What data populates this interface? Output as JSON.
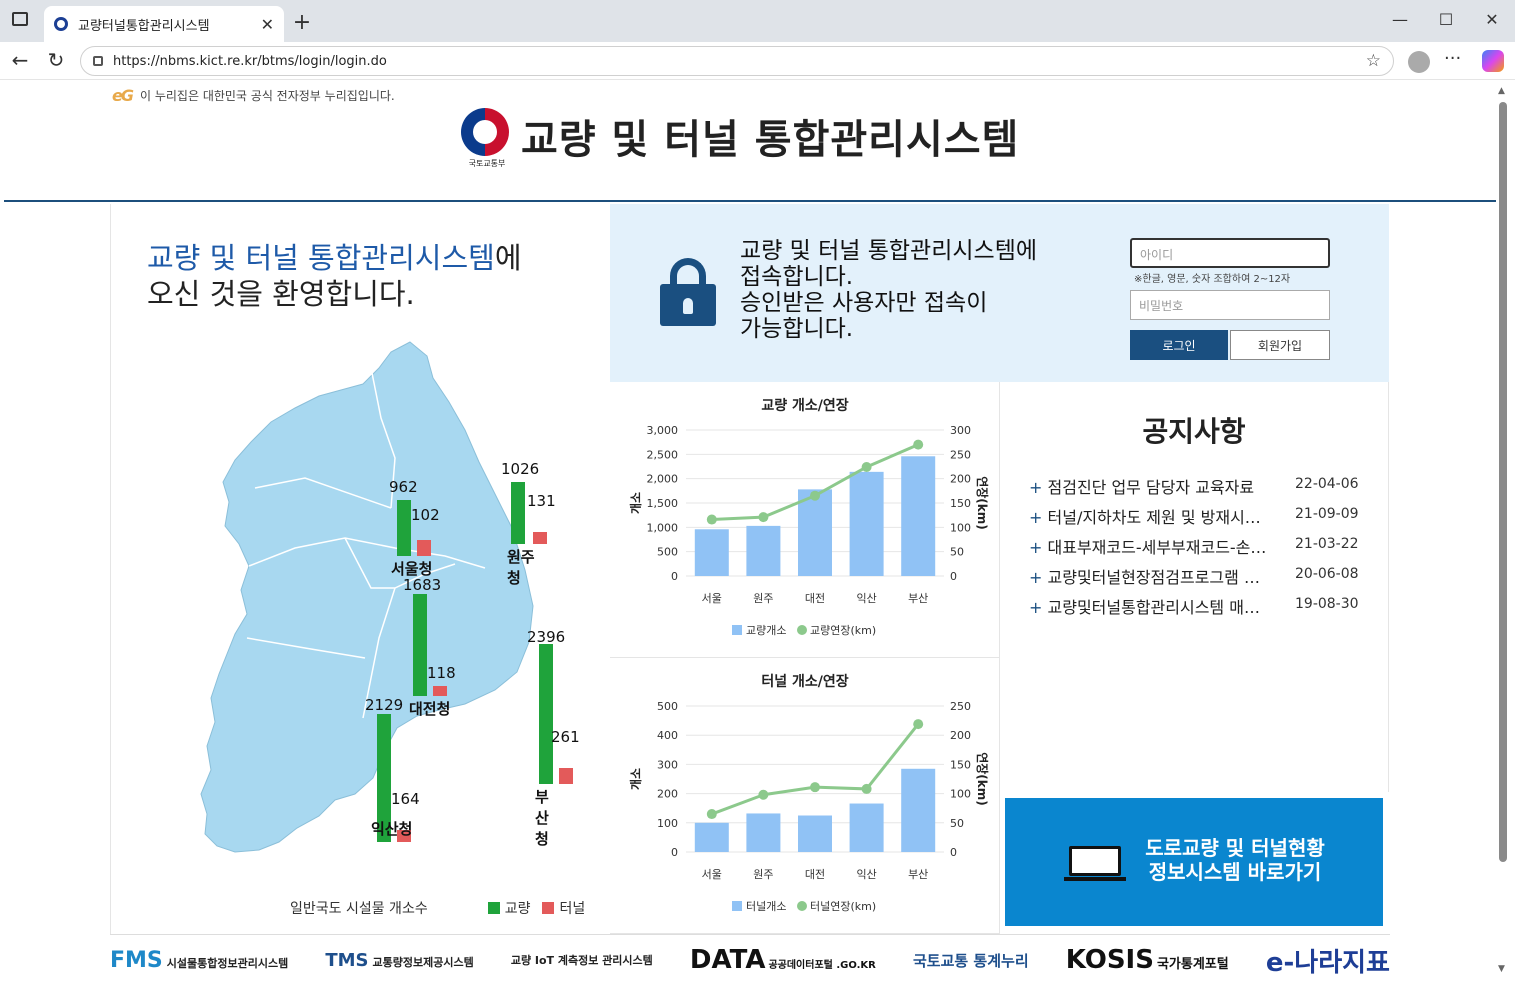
{
  "browser": {
    "tab_title": "교량터널통합관리시스템",
    "url": "https://nbms.kict.re.kr/btms/login/login.do"
  },
  "gov_notice": "이 누리집은 대한민국 공식 전자정부 누리집입니다.",
  "header": {
    "ministry": "국토교통부",
    "title": "교량 및 터널 통합관리시스템"
  },
  "welcome": {
    "highlight": "교량 및 터널 통합관리시스템",
    "suffix": "에",
    "line2": "오신 것을 환영합니다."
  },
  "map": {
    "regions": [
      {
        "name": "서울청",
        "bridges": 962,
        "tunnels": 102
      },
      {
        "name": "원주청",
        "bridges": 1026,
        "tunnels": 131
      },
      {
        "name": "대전청",
        "bridges": 1683,
        "tunnels": 118
      },
      {
        "name": "부산청",
        "bridges": 2396,
        "tunnels": 261
      },
      {
        "name": "익산청",
        "bridges": 2129,
        "tunnels": 164
      }
    ],
    "legend_caption": "일반국도 시설물 개소수",
    "legend_bridge": "교량",
    "legend_tunnel": "터널",
    "colors": {
      "bridge": "#1fa33b",
      "tunnel": "#e35a5a",
      "land": "#a8d8f0"
    }
  },
  "login": {
    "message_line1": "교량 및 터널 통합관리시스템에",
    "message_line2": "접속합니다.",
    "message_line3": "승인받은 사용자만 접속이",
    "message_line4": "가능합니다.",
    "id_placeholder": "아이디",
    "id_hint": "※한글, 영문, 숫자 조합하여 2~12자",
    "pw_placeholder": "비밀번호",
    "login_label": "로그인",
    "join_label": "회원가입"
  },
  "notice": {
    "title": "공지사항",
    "items": [
      {
        "title": "점검진단 업무 담당자 교육자료",
        "date": "22-04-06"
      },
      {
        "title": "터널/지하차도 제원 및 방재시…",
        "date": "21-09-09"
      },
      {
        "title": "대표부재코드-세부부재코드-손…",
        "date": "21-03-22"
      },
      {
        "title": "교량및터널현장점검프로그램 …",
        "date": "20-06-08"
      },
      {
        "title": "교량및터널통합관리시스템 매…",
        "date": "19-08-30"
      }
    ]
  },
  "portal": {
    "line1": "도로교량 및 터널현황",
    "line2": "정보시스템 바로가기"
  },
  "footer": {
    "logos": [
      "FMS",
      "시설물통합정보관리시스템",
      "TMS",
      "교통량정보제공시스템",
      "교량 IoT 계측정보 관리시스템",
      "DATA",
      "공공데이터포털 .GO.KR",
      "국토교통 통계누리",
      "KOSIS",
      "국가통계포털",
      "e-나라지표"
    ]
  },
  "chart_data": [
    {
      "type": "bar",
      "title": "교량 개소/연장",
      "categories": [
        "서울",
        "원주",
        "대전",
        "익산",
        "부산"
      ],
      "ylabel": "개소",
      "y2label": "연장(km)",
      "ylim": [
        0,
        3000
      ],
      "yticks": [
        "3,000",
        "2,500",
        "2,000",
        "1,500",
        "1,000",
        "500",
        "0"
      ],
      "y2lim": [
        0,
        300
      ],
      "y2ticks": [
        "300",
        "250",
        "200",
        "150",
        "100",
        "50",
        "0"
      ],
      "series": [
        {
          "name": "교량개소",
          "type": "bar",
          "axis": "left",
          "values": [
            960,
            1030,
            1780,
            2140,
            2460
          ],
          "color": "#90c2f5"
        },
        {
          "name": "교량연장(km)",
          "type": "line",
          "axis": "right",
          "values": [
            116,
            121,
            165,
            224,
            270
          ],
          "color": "#8cc98c"
        }
      ],
      "legend": "bottom"
    },
    {
      "type": "bar",
      "title": "터널 개소/연장",
      "categories": [
        "서울",
        "원주",
        "대전",
        "익산",
        "부산"
      ],
      "ylabel": "개소",
      "y2label": "연장(km)",
      "ylim": [
        0,
        500
      ],
      "yticks": [
        "500",
        "400",
        "300",
        "200",
        "100",
        "0"
      ],
      "y2lim": [
        0,
        250
      ],
      "y2ticks": [
        "250",
        "200",
        "150",
        "100",
        "50",
        "0"
      ],
      "series": [
        {
          "name": "터널개소",
          "type": "bar",
          "axis": "left",
          "values": [
            100,
            132,
            125,
            166,
            285
          ],
          "color": "#90c2f5"
        },
        {
          "name": "터널연장(km)",
          "type": "line",
          "axis": "right",
          "values": [
            65,
            98,
            111,
            108,
            219
          ],
          "color": "#8cc98c"
        }
      ],
      "legend": "bottom"
    }
  ]
}
